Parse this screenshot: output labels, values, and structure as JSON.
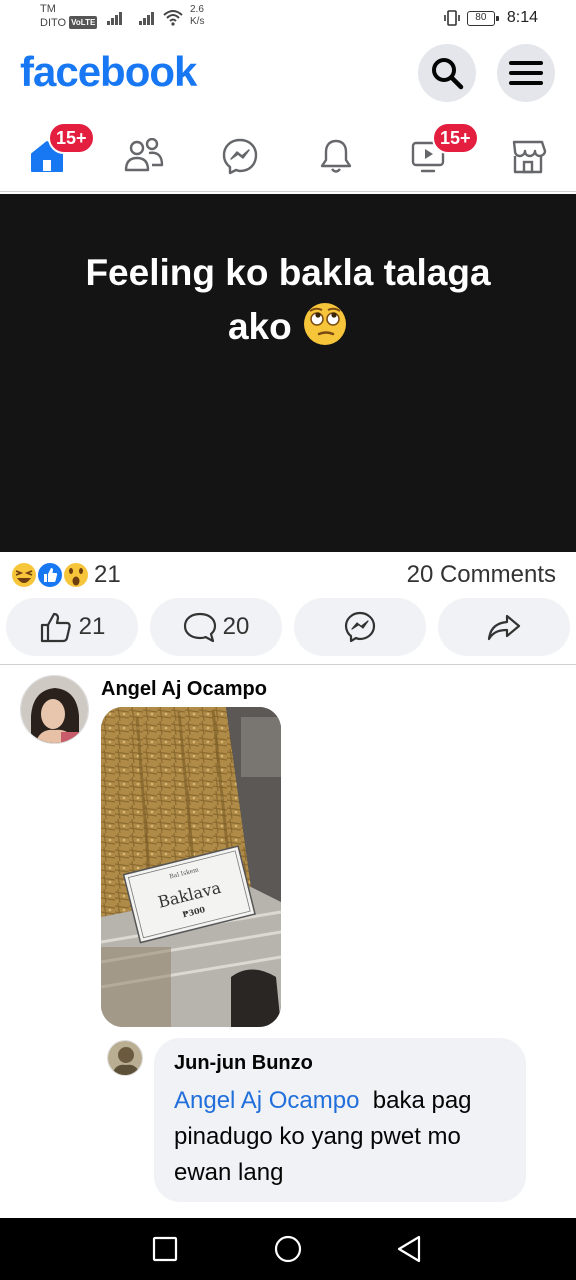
{
  "status_bar": {
    "carrier_line1": "TM",
    "carrier_line2": "DITO",
    "volte": "VoLTE",
    "speed_value": "2.6",
    "speed_unit": "K/s",
    "battery": "80",
    "time": "8:14"
  },
  "header": {
    "logo": "facebook",
    "brand_color": "#1877f2"
  },
  "nav": {
    "tabs": [
      {
        "name": "home",
        "icon": "home-icon",
        "badge": "15+"
      },
      {
        "name": "friends",
        "icon": "friends-icon",
        "badge": ""
      },
      {
        "name": "messenger",
        "icon": "messenger-icon",
        "badge": ""
      },
      {
        "name": "notifications",
        "icon": "bell-icon",
        "badge": ""
      },
      {
        "name": "watch",
        "icon": "video-icon",
        "badge": "15+"
      },
      {
        "name": "marketplace",
        "icon": "marketplace-icon",
        "badge": ""
      }
    ]
  },
  "post": {
    "text_line1": "Feeling ko bakla talaga",
    "text_line2": "ako",
    "emoji": "🙄",
    "background": "#141414"
  },
  "reactions": {
    "icons": [
      "haha-icon",
      "like-icon",
      "wow-icon"
    ],
    "count": "21",
    "comments": "20 Comments"
  },
  "actions": {
    "like_count": "21",
    "comment_count": "20"
  },
  "comments": [
    {
      "author": "Angel Aj Ocampo",
      "photo_sign_title": "Baklava",
      "photo_sign_price": "₱300"
    },
    {
      "author": "Jun-jun Bunzo",
      "mention": "Angel Aj Ocampo",
      "text_after_mention": "  baka pag",
      "text_rest": "pinadugo ko yang pwet mo ewan lang"
    }
  ]
}
